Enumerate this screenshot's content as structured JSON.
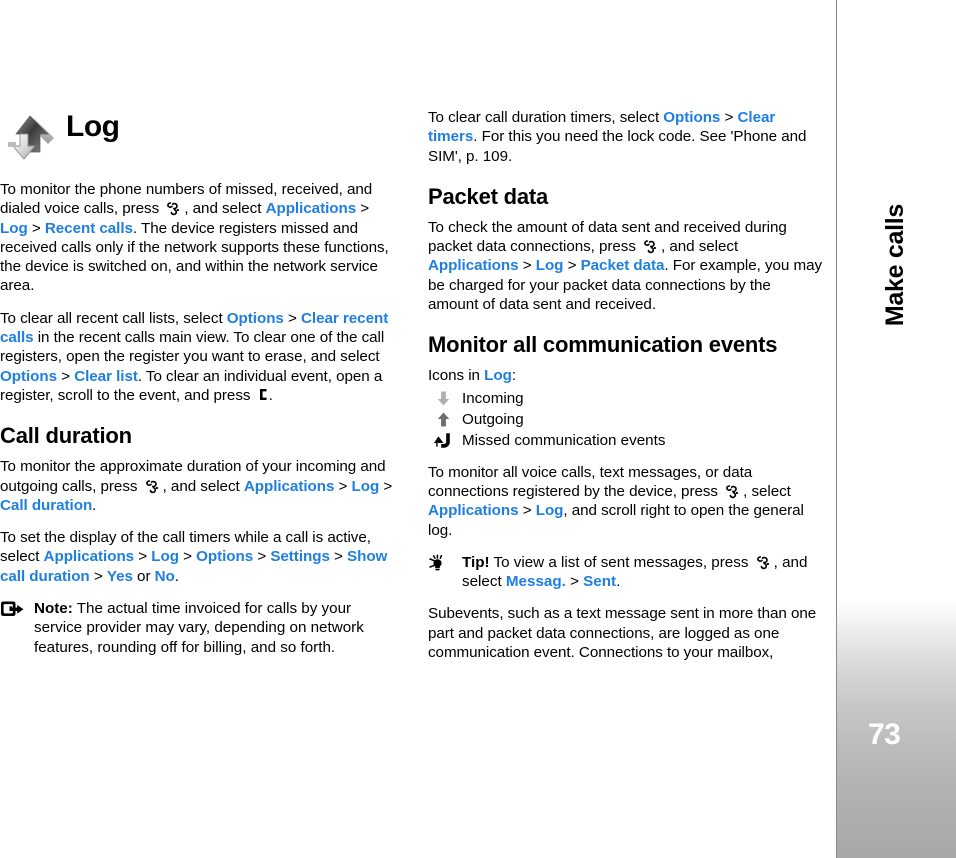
{
  "chapter": {
    "title": "Log",
    "icon": "log-arrows-icon"
  },
  "sidebar": {
    "section_label": "Make calls",
    "page_number": "73"
  },
  "colors": {
    "link_blue": "#1f7fe0",
    "text_black": "#000000",
    "sidebar_gray": "#a8a8a8"
  },
  "left_column": {
    "p_monitor_numbers": {
      "t1": "To monitor the phone numbers of missed, received, and dialed voice calls, press ",
      "key": "menu-key-icon",
      "t2": ", and select ",
      "l1": "Applications",
      "g1": " > ",
      "l2": "Log",
      "g2": " > ",
      "l3": "Recent calls",
      "t3": ". The device registers missed and received calls only if the network supports these functions, the device is switched on, and within the network service area."
    },
    "p_clear_lists": {
      "t1": "To clear all recent call lists, select ",
      "l1": "Options",
      "g1": " > ",
      "l2": "Clear recent calls",
      "t2": " in the recent calls main view. To clear one of the call registers, open the register you want to erase, and select ",
      "l3": "Options",
      "g2": " > ",
      "l4": "Clear list",
      "t3": ". To clear an individual event, open a register, scroll to the event, and press ",
      "key": "clear-key-icon",
      "t4": "."
    },
    "h_call_duration": "Call duration",
    "p_call_duration": {
      "t1": "To monitor the approximate duration of your incoming and outgoing calls, press ",
      "key": "menu-key-icon",
      "t2": ", and select ",
      "l1": "Applications",
      "g1": " > ",
      "l2": "Log",
      "g2": " > ",
      "l3": "Call duration",
      "t3": "."
    },
    "p_call_timers": {
      "t1": "To set the display of the call timers while a call is active, select ",
      "l1": "Applications",
      "g1": " > ",
      "l2": "Log",
      "g2": " > ",
      "l3": "Options",
      "g3": " > ",
      "l4": "Settings",
      "g4": " > ",
      "l5": "Show call duration",
      "g5": " > ",
      "l6": "Yes",
      "t2": " or ",
      "l7": "No",
      "t3": "."
    },
    "note": {
      "icon": "note-icon",
      "label": "Note:",
      "text": " The actual time invoiced for calls by your service provider may vary, depending on network features, rounding off for billing, and so forth."
    }
  },
  "right_column": {
    "p_clear_timers": {
      "t1": "To clear call duration timers, select ",
      "l1": "Options",
      "g1": " > ",
      "l2": "Clear timers",
      "t2": ". For this you need the lock code. See 'Phone and SIM', p. 109."
    },
    "h_packet_data": "Packet data",
    "p_packet_data": {
      "t1": "To check the amount of data sent and received during packet data connections, press ",
      "key": "menu-key-icon",
      "t2": ", and select ",
      "l1": "Applications",
      "g1": " > ",
      "l2": "Log",
      "g2": " > ",
      "l3": "Packet data",
      "t3": ". For example, you may be charged for your packet data connections by the amount of data sent and received."
    },
    "h_monitor_events": "Monitor all communication events",
    "icons_intro": {
      "t1": "Icons in ",
      "l1": "Log",
      "t2": ":"
    },
    "icon_legend": [
      {
        "icon": "arrow-down-icon",
        "label": "Incoming",
        "color": "#b0b0b0"
      },
      {
        "icon": "arrow-up-icon",
        "label": "Outgoing",
        "color": "#6e6e6e"
      },
      {
        "icon": "missed-call-icon",
        "label": "Missed communication events",
        "color": "#000000"
      }
    ],
    "p_monitor_all": {
      "t1": "To monitor all voice calls, text messages, or data connections registered by the device, press ",
      "key": "menu-key-icon",
      "t2": ", select ",
      "l1": "Applications",
      "g1": " > ",
      "l2": "Log",
      "t3": ", and scroll right to open the general log."
    },
    "tip": {
      "icon": "tip-bulb-icon",
      "label": "Tip!",
      "t1": " To view a list of sent messages, press ",
      "key": "menu-key-icon",
      "t2": ", and select ",
      "l1": "Messag.",
      "g1": " > ",
      "l2": "Sent",
      "t3": "."
    },
    "p_subevents": {
      "t1": "Subevents, such as a text message sent in more than one part and packet data connections, are logged as one communication event. Connections to your mailbox,"
    }
  }
}
